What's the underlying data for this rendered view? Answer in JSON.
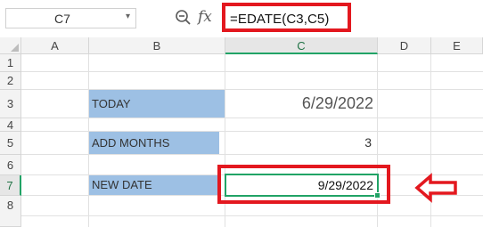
{
  "formula_bar": {
    "name_box": "C7",
    "name_box_caret": "▾",
    "fx_label": "fx",
    "formula": "=EDATE(C3,C5)"
  },
  "columns": [
    "A",
    "B",
    "C",
    "D",
    "E"
  ],
  "rows": [
    "1",
    "2",
    "3",
    "4",
    "5",
    "6",
    "7",
    "8"
  ],
  "cells": {
    "B3": "TODAY",
    "C3": "6/29/2022",
    "B5": "ADD MONTHS",
    "C5": "3",
    "B7": "NEW DATE",
    "C7": "9/29/2022"
  },
  "active_cell": "C7",
  "colors": {
    "label_fill": "#9dc0e4",
    "highlight_red": "#e3181f",
    "selection_green": "#21a366"
  },
  "icons": [
    "zoom-icon",
    "fx-icon",
    "left-arrow-icon"
  ]
}
